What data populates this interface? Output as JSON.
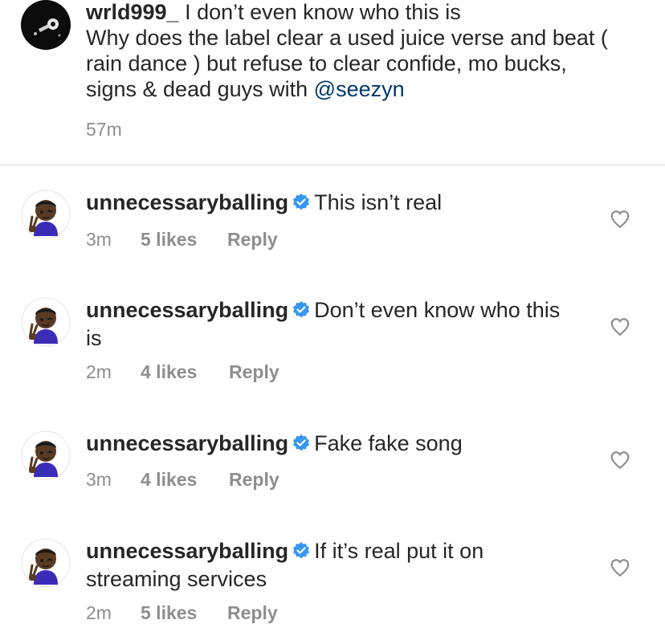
{
  "parent_comment": {
    "username": "wrld999_",
    "text_line1": " I don’t even know who this is",
    "text_body": "Why does the label clear a used juice verse and beat ( rain dance ) but refuse to clear confide, mo bucks, signs & dead guys with ",
    "mention": "@seezyn",
    "time": "57m"
  },
  "replies": [
    {
      "username": "unnecessaryballing",
      "text": "This isn’t real",
      "time": "3m",
      "likes": "5 likes",
      "reply_label": "Reply"
    },
    {
      "username": "unnecessaryballing",
      "text": "Don’t even know who this is",
      "time": "2m",
      "likes": "4 likes",
      "reply_label": "Reply"
    },
    {
      "username": "unnecessaryballing",
      "text": "Fake fake song",
      "time": "3m",
      "likes": "4 likes",
      "reply_label": "Reply"
    },
    {
      "username": "unnecessaryballing",
      "text": "If it’s real put it on streaming services",
      "time": "2m",
      "likes": "5 likes",
      "reply_label": "Reply"
    }
  ],
  "icons": {
    "verified": "verified-badge-icon",
    "like": "heart-icon"
  },
  "colors": {
    "text": "#262626",
    "secondary": "#8e8e8e",
    "mention": "#00376b",
    "verified": "#3897f0",
    "divider": "#dbdbdb"
  }
}
